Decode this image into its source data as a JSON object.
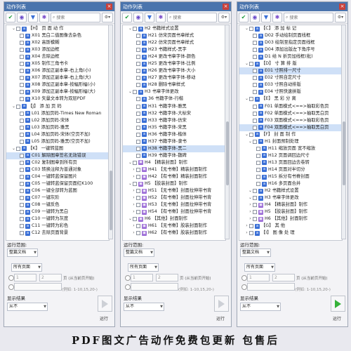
{
  "colors": {
    "titlebar": "#4a74ad",
    "selection": "#cfe0f7",
    "run_active": "#36b23a"
  },
  "panels": [
    {
      "title": "动作列表",
      "search_placeholder": "搜索",
      "scroll": {
        "thumb_top_frac": 0.68,
        "thumb_frac": 0.28
      },
      "rows": [
        {
          "indent": 1,
          "exp": "⌄",
          "mod": false,
          "text": "【H】 页 面 动 作",
          "selected": false
        },
        {
          "indent": 2,
          "exp": "",
          "mod": false,
          "text": "X01 黑白二值图像去杂色",
          "selected": false
        },
        {
          "indent": 2,
          "exp": "",
          "mod": false,
          "text": "X02 高斯模糊",
          "selected": false
        },
        {
          "indent": 2,
          "exp": "",
          "mod": false,
          "text": "X03 添加边框",
          "selected": false
        },
        {
          "indent": 2,
          "exp": "",
          "mod": false,
          "text": "X04 去除边框",
          "selected": false
        },
        {
          "indent": 2,
          "exp": "",
          "mod": false,
          "text": "X05 制作三角书卡",
          "selected": false
        },
        {
          "indent": 2,
          "exp": "",
          "mod": false,
          "text": "X06 添加正副本章-右上角(小)",
          "selected": false
        },
        {
          "indent": 2,
          "exp": "",
          "mod": false,
          "text": "X07 添加正副本章-右上角(大)",
          "selected": false
        },
        {
          "indent": 2,
          "exp": "",
          "mod": false,
          "text": "X08 添加正副本章-按幅形幅(小)",
          "selected": false
        },
        {
          "indent": 2,
          "exp": "",
          "mod": false,
          "text": "X09 添加正副本章-按幅形幅(大)",
          "selected": false
        },
        {
          "indent": 2,
          "exp": "",
          "mod": false,
          "text": "X10 矢量文本转为双层PDF",
          "selected": false
        },
        {
          "indent": 1,
          "exp": "⌄",
          "mod": false,
          "text": "【J】 添 加 页 码",
          "selected": false
        },
        {
          "indent": 2,
          "exp": "",
          "mod": false,
          "text": "L01 添加页码-Times New Roman",
          "selected": false
        },
        {
          "indent": 2,
          "exp": "",
          "mod": false,
          "text": "L02 添加页码-宋体",
          "selected": false
        },
        {
          "indent": 2,
          "exp": "",
          "mod": false,
          "text": "L03 添加页码-雅黑",
          "selected": false
        },
        {
          "indent": 2,
          "exp": "",
          "mod": false,
          "text": "L04 添加页码-宋体(空页不加)",
          "selected": false
        },
        {
          "indent": 2,
          "exp": "",
          "mod": false,
          "text": "L05 添加页码-雅黑(空页不加)",
          "selected": false
        },
        {
          "indent": 1,
          "exp": "⌄",
          "mod": false,
          "text": "【K】 一键转蓝图",
          "selected": false
        },
        {
          "indent": 2,
          "exp": "",
          "mod": false,
          "text": "C01 解除图章签名无效错误",
          "selected": true
        },
        {
          "indent": 2,
          "exp": "",
          "mod": false,
          "text": "C02 复制图章到所有页",
          "selected": false
        },
        {
          "indent": 2,
          "exp": "",
          "mod": false,
          "text": "C03 转换注释为普通对象",
          "selected": false
        },
        {
          "indent": 2,
          "exp": "",
          "mod": false,
          "text": "C04 一键转蓝保留图片",
          "selected": false
        },
        {
          "indent": 2,
          "exp": "",
          "mod": false,
          "text": "C05 一键转蓝保留页面红K100",
          "selected": false
        },
        {
          "indent": 2,
          "exp": "",
          "mod": false,
          "text": "C06 一键全部转为蓝图",
          "selected": false
        },
        {
          "indent": 2,
          "exp": "",
          "mod": false,
          "text": "C07 一键灰阶",
          "selected": false
        },
        {
          "indent": 2,
          "exp": "",
          "mod": false,
          "text": "C08 一键反色",
          "selected": false
        },
        {
          "indent": 2,
          "exp": "",
          "mod": false,
          "text": "C09 一键转为黑白",
          "selected": false
        },
        {
          "indent": 2,
          "exp": "",
          "mod": false,
          "text": "C10 一键转为灰度",
          "selected": false
        },
        {
          "indent": 2,
          "exp": "",
          "mod": false,
          "text": "C11 一键转为彩色",
          "selected": false
        },
        {
          "indent": 2,
          "exp": "",
          "mod": false,
          "text": "C12 去除页面背景",
          "selected": false
        }
      ],
      "run_scope_label": "运行范围:",
      "scope_value": "整篇文档",
      "pages_value": "所有页面",
      "page_from": "1",
      "page_to": "2",
      "page_hint": "页 (从当前页开始)",
      "example_hint": "(例如: 1-10,15,20-)",
      "display_label": "显示结果",
      "display_value": "从不",
      "run_label": "运行",
      "run_active": false
    },
    {
      "title": "动作列表",
      "search_placeholder": "搜索",
      "scroll": {
        "thumb_top_frac": 0.45,
        "thumb_frac": 0.3
      },
      "rows": [
        {
          "indent": 1,
          "exp": "⌄",
          "mod": false,
          "text": "H2 书籍样式设置",
          "selected": false
        },
        {
          "indent": 2,
          "exp": "",
          "mod": false,
          "text": "H21 仿宋页面书章样式",
          "selected": false
        },
        {
          "indent": 2,
          "exp": "",
          "mod": false,
          "text": "H22 仿宋页面书章样式",
          "selected": false
        },
        {
          "indent": 2,
          "exp": "",
          "mod": false,
          "text": "H23 书籍样式-黑字",
          "selected": false
        },
        {
          "indent": 2,
          "exp": "",
          "mod": false,
          "text": "H24 更改书章字体-颜色",
          "selected": false
        },
        {
          "indent": 2,
          "exp": "",
          "mod": false,
          "text": "H25 更改书章字体-比例",
          "selected": false
        },
        {
          "indent": 2,
          "exp": "",
          "mod": false,
          "text": "H26 更改书章字体-大小",
          "selected": false
        },
        {
          "indent": 2,
          "exp": "",
          "mod": false,
          "text": "H27 更改书章字体-移动",
          "selected": false
        },
        {
          "indent": 2,
          "exp": "",
          "mod": false,
          "text": "H28 删除书章样式",
          "selected": false
        },
        {
          "indent": 1,
          "exp": "⌄",
          "mod": false,
          "text": "H3 书章字体更改",
          "selected": false
        },
        {
          "indent": 2,
          "exp": "",
          "mod": false,
          "text": "36 书籍字体-行楷",
          "selected": false
        },
        {
          "indent": 2,
          "exp": "",
          "mod": false,
          "text": "H31 书籍字体-雅黑",
          "selected": false
        },
        {
          "indent": 2,
          "exp": "",
          "mod": false,
          "text": "H32 书籍字体-大标宋",
          "selected": false
        },
        {
          "indent": 2,
          "exp": "",
          "mod": false,
          "text": "H33 书籍字体-仿宋",
          "selected": false
        },
        {
          "indent": 2,
          "exp": "",
          "mod": false,
          "text": "H35 书籍字体-宋黑",
          "selected": false
        },
        {
          "indent": 2,
          "exp": "",
          "mod": false,
          "text": "H36 书籍字体-楷体",
          "selected": false
        },
        {
          "indent": 2,
          "exp": "",
          "mod": false,
          "text": "H37 书籍字体-隶书",
          "selected": false
        },
        {
          "indent": 2,
          "exp": "",
          "mod": false,
          "text": "H38 书籍字体-黑二",
          "selected": true
        },
        {
          "indent": 2,
          "exp": "",
          "mod": false,
          "text": "H39 书籍字体-魏碑",
          "selected": false
        },
        {
          "indent": 1,
          "exp": "⌄",
          "mod": true,
          "text": "H4 【精装封面】制作",
          "selected": false
        },
        {
          "indent": 2,
          "exp": "›",
          "mod": true,
          "text": "H41 【无书脊】精装封面制作",
          "selected": false
        },
        {
          "indent": 2,
          "exp": "›",
          "mod": true,
          "text": "H42 【有书脊】精装封面制作",
          "selected": false
        },
        {
          "indent": 1,
          "exp": "⌄",
          "mod": true,
          "text": "H5 【胶装封面】制作",
          "selected": false
        },
        {
          "indent": 2,
          "exp": "›",
          "mod": true,
          "text": "H51 【无书脊】封面拉伸带书背",
          "selected": false
        },
        {
          "indent": 2,
          "exp": "›",
          "mod": true,
          "text": "H52 【有书脊】封面拉伸带书背",
          "selected": false
        },
        {
          "indent": 2,
          "exp": "›",
          "mod": true,
          "text": "H53 【无书脊】封面拉伸带书背",
          "selected": false
        },
        {
          "indent": 2,
          "exp": "›",
          "mod": true,
          "text": "H54 【有书脊】封面拉伸带书背",
          "selected": false
        },
        {
          "indent": 1,
          "exp": "⌄",
          "mod": true,
          "text": "H6 【其他】封面制作",
          "selected": false
        },
        {
          "indent": 2,
          "exp": "›",
          "mod": true,
          "text": "H61 【无书脊】胶装封面制作",
          "selected": false
        },
        {
          "indent": 2,
          "exp": "›",
          "mod": true,
          "text": "H62 【有书脊】胶装封面制作",
          "selected": false
        }
      ],
      "run_scope_label": "运行范围:",
      "scope_value": "整篇文档",
      "pages_value": "所有页面",
      "page_from": "1",
      "page_to": "2",
      "page_hint": "页 (从当前页开始)",
      "example_hint": "(例如: 1-10,15,20-)",
      "display_label": "显示结果",
      "display_value": "从不",
      "run_label": "运行",
      "run_active": false
    },
    {
      "title": "动作列表",
      "search_placeholder": "搜索",
      "scroll": {
        "thumb_top_frac": 0.45,
        "thumb_frac": 0.3
      },
      "rows": [
        {
          "indent": 1,
          "exp": "⌄",
          "mod": false,
          "text": "【C】 添 加 标 记",
          "selected": false
        },
        {
          "indent": 2,
          "exp": "",
          "mod": false,
          "text": "D02 手动绘制页面线框",
          "selected": false
        },
        {
          "indent": 2,
          "exp": "",
          "mod": false,
          "text": "D03 绘制至指定页面线框",
          "selected": false
        },
        {
          "indent": 2,
          "exp": "",
          "mod": false,
          "text": "D04 添加出版左下角序号",
          "selected": false
        },
        {
          "indent": 2,
          "exp": "",
          "mod": false,
          "text": "D1 给 N 折页加线框(批)",
          "selected": false
        },
        {
          "indent": 1,
          "exp": "⌄",
          "mod": false,
          "text": "【D】 寸 算 排 版",
          "selected": false
        },
        {
          "indent": 2,
          "exp": "",
          "mod": false,
          "text": "E01 寸照排一尺寸",
          "selected": true
        },
        {
          "indent": 2,
          "exp": "",
          "mod": false,
          "text": "E02 寸照自定尺寸",
          "selected": false
        },
        {
          "indent": 2,
          "exp": "",
          "mod": false,
          "text": "E03 寸照自动排版",
          "selected": false
        },
        {
          "indent": 2,
          "exp": "",
          "mod": false,
          "text": "E04 寸照快速拼版",
          "selected": false
        },
        {
          "indent": 1,
          "exp": "⌄",
          "mod": false,
          "text": "【E】 黑 彩 分 离",
          "selected": false
        },
        {
          "indent": 2,
          "exp": "",
          "mod": false,
          "text": "F01 单面模式<==>抽取彩色页",
          "selected": false
        },
        {
          "indent": 2,
          "exp": "",
          "mod": false,
          "text": "F02 单面模式<==>抽取黑白页",
          "selected": false
        },
        {
          "indent": 2,
          "exp": "",
          "mod": false,
          "text": "F03 双面模式<==>抽取彩色页",
          "selected": false
        },
        {
          "indent": 2,
          "exp": "",
          "mod": false,
          "text": "F04 双面模式<==>抽取黑白页",
          "selected": true
        },
        {
          "indent": 1,
          "exp": "⌄",
          "mod": false,
          "text": "【F】 封 面 制 作",
          "selected": false
        },
        {
          "indent": 2,
          "exp": "⌄",
          "mod": false,
          "text": "H1 封面预制处理",
          "selected": false
        },
        {
          "indent": 3,
          "exp": "",
          "mod": false,
          "text": "H11 缩放页面 宽不缩放",
          "selected": false
        },
        {
          "indent": 3,
          "exp": "",
          "mod": false,
          "text": "H12 页面调回边尺寸",
          "selected": false
        },
        {
          "indent": 3,
          "exp": "",
          "mod": false,
          "text": "H13 页面回边去卷转",
          "selected": false
        },
        {
          "indent": 3,
          "exp": "",
          "mod": false,
          "text": "H14 页面对半切分",
          "selected": false
        },
        {
          "indent": 3,
          "exp": "",
          "mod": false,
          "text": "H15 拆分有书脊封面",
          "selected": false
        },
        {
          "indent": 3,
          "exp": "",
          "mod": false,
          "text": "H16 多页面合并",
          "selected": false
        },
        {
          "indent": 2,
          "exp": "⌄",
          "mod": false,
          "text": "H2 书籍样式设置",
          "selected": false
        },
        {
          "indent": 2,
          "exp": "⌄",
          "mod": false,
          "text": "H3 书章字体更改",
          "selected": false
        },
        {
          "indent": 2,
          "exp": "›",
          "mod": true,
          "text": "H4 【精装封面】制作",
          "selected": false
        },
        {
          "indent": 2,
          "exp": "›",
          "mod": true,
          "text": "H5 【胶装封面】制作",
          "selected": false
        },
        {
          "indent": 2,
          "exp": "›",
          "mod": true,
          "text": "H6 【其他】封面制作",
          "selected": false
        },
        {
          "indent": 1,
          "exp": "›",
          "mod": false,
          "text": "【G】 其 他",
          "selected": false
        },
        {
          "indent": 1,
          "exp": "›",
          "mod": false,
          "text": "【I】 图 像 处 理",
          "selected": false
        }
      ],
      "run_scope_label": "运行范围:",
      "scope_value": "整篇文档",
      "pages_value": "所有页面",
      "page_from": "1",
      "page_to": "2",
      "page_hint": "页 (从当前页开始)",
      "example_hint": "(例如: 1-10,15,20-)",
      "display_label": "显示结果",
      "display_value": "从不",
      "run_label": "运行",
      "run_active": true
    }
  ],
  "banner": "PDF图文广告动作免费包更新  包售后"
}
